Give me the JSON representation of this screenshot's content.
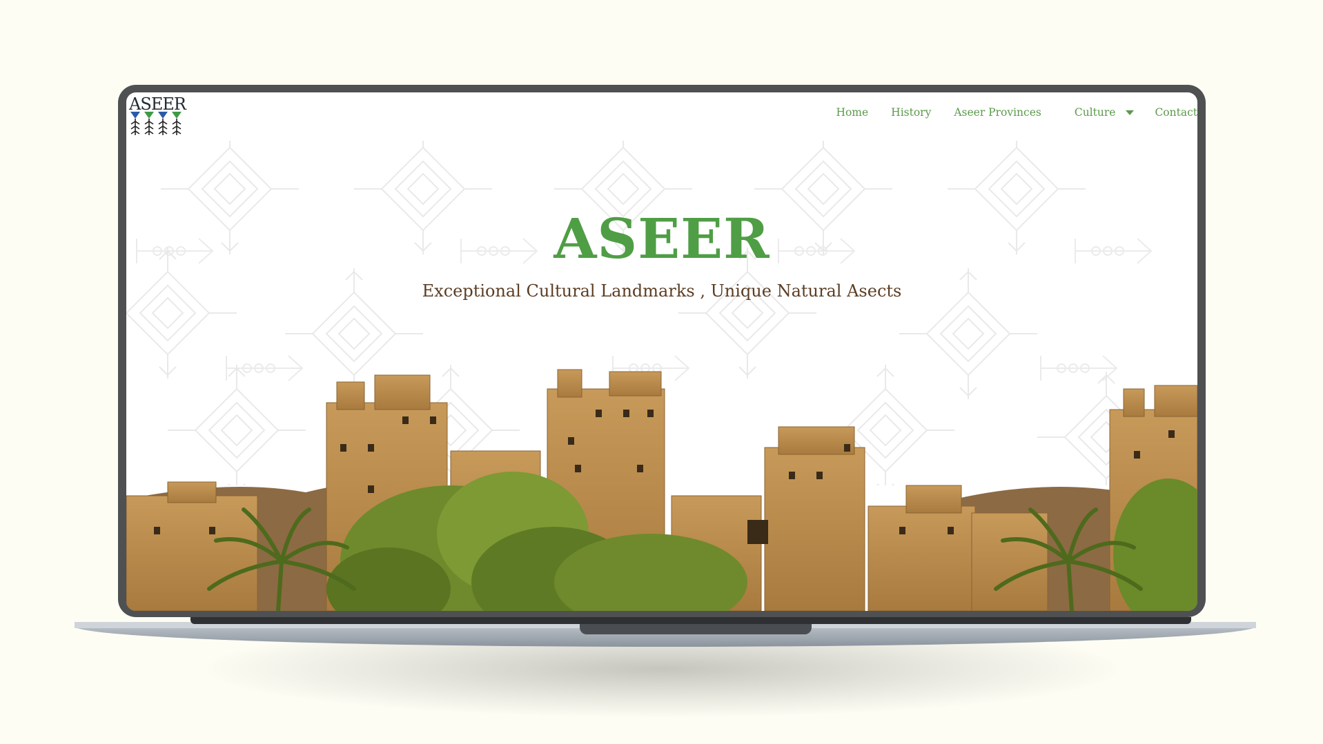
{
  "site": {
    "logo_text": "ASEER"
  },
  "nav": {
    "items": [
      {
        "label": "Home"
      },
      {
        "label": "History"
      },
      {
        "label": "Aseer Provinces"
      },
      {
        "label": "Culture"
      },
      {
        "label": "Contact"
      }
    ]
  },
  "hero": {
    "title": "ASEER",
    "subtitle": "Exceptional Cultural Landmarks , Unique Natural Asects"
  },
  "colors": {
    "accent_green": "#4f9e45",
    "nav_green": "#5b9a4b",
    "subtitle_brown": "#5b3d23",
    "page_background": "#fdfdf4",
    "bezel": "#4f5052"
  },
  "icons": {
    "dropdown": "chevron-down-icon"
  }
}
